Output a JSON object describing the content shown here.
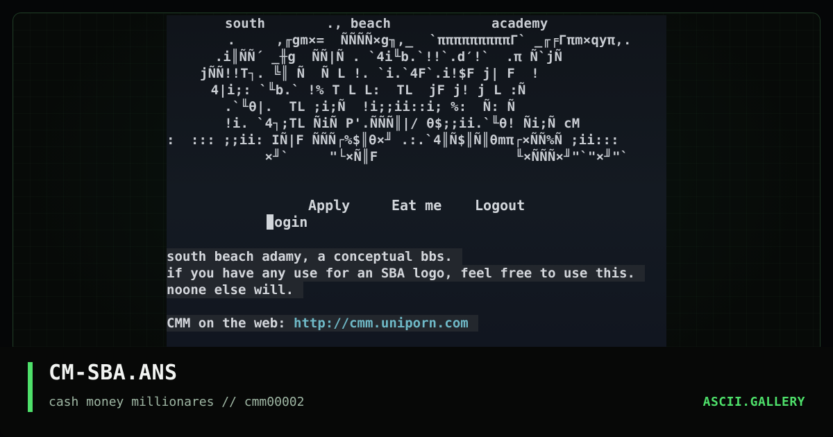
{
  "ansi_art": {
    "header_words": [
      "south",
      "., beach",
      "academy"
    ],
    "logo_lines": [
      " .     ,╓gm×=  ÑÑÑÑ×g╖,_  `πππππππππΓ` _╓╒Γπm×qyπ,.",
      " .i║ÑÑ´ _╫g  ÑÑ|Ñ . `4i╙b.`!!`.d′!`  .π Ñ`jÑ",
      "jÑÑ!!T┐. ╚║ Ñ  Ñ L !. `i.`4F`.i!$F j| F  !",
      " 4|i;: `╙b.` !% T L L:  TL  jF j! j L :Ñ",
      "  .`╙θ|.  TL ;i;Ñ  !i;;ii::i; %:  Ñ: Ñ",
      "  !i. `4┐;TL ÑiÑ P'.ÑÑÑ║|/ θ$;;ii.`╙θ! Ñi;Ñ cM",
      ":  ::: ;;ii: IÑ|F ÑÑÑ┌%$║θ×╜ .:.`4║Ñ$║Ñ║θmπ┌×ÑÑ%Ñ ;ii:::",
      "       ×╜`     \"└×Ñ║F                 ╙×ÑÑÑ×╜\"`\"×╜\"`"
    ]
  },
  "menu": {
    "login_label": "ogin",
    "apply_label": "Apply",
    "eat_me_label": "Eat me",
    "logout_label": "Logout"
  },
  "info": {
    "line1": "south beach adamy, a conceptual bbs.",
    "line2": "if you have any use for an SBA logo, feel free to use this.",
    "line3": "noone else will.",
    "web_label": "CMM on the web:",
    "web_url": "http://cmm.uniporn.com"
  },
  "footer": {
    "title": "CM-SBA.ANS",
    "subtitle": "cash money millionares // cmm00002",
    "brand": "ASCII.GALLERY"
  },
  "colors": {
    "accent": "#4ee06a",
    "link": "#6fb9c7",
    "terminal_bg": "#141a22"
  }
}
